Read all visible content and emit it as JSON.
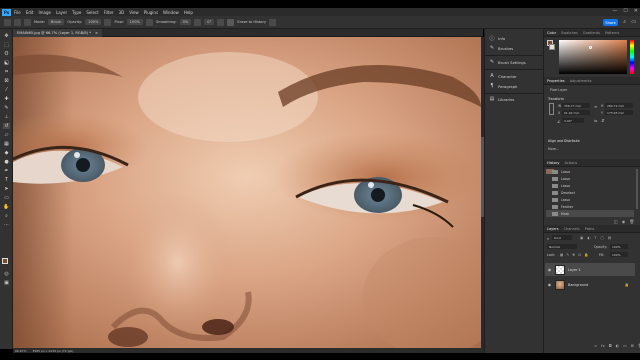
{
  "app": {
    "logo": "Ps"
  },
  "menu": [
    "File",
    "Edit",
    "Image",
    "Layer",
    "Type",
    "Select",
    "Filter",
    "3D",
    "View",
    "Plugins",
    "Window",
    "Help"
  ],
  "window_controls": {
    "minimize": "—",
    "maximize": "☐",
    "close": "✕"
  },
  "options": {
    "mode_label": "Mode:",
    "mode_value": "Brush",
    "opacity_label": "Opacity:",
    "opacity_value": "100%",
    "flow_label": "Flow:",
    "flow_value": "100%",
    "smoothing_label": "Smoothing:",
    "smoothing_value": "0%",
    "angle_value": "0°",
    "erase_history_label": "Erase to History",
    "share_label": "Share"
  },
  "document": {
    "tab_title": "EMAIN65.jpg @ 66.7% (Layer 1, RGB/8) *",
    "close": "×"
  },
  "status": {
    "zoom": "66.67%",
    "size": "3585 px x 2239 px (72 ppi)"
  },
  "dock_items": [
    {
      "icon": "info-icon",
      "glyph": "ⓘ",
      "label": "Info"
    },
    {
      "icon": "brushes-icon",
      "glyph": "✎",
      "label": "Brushes"
    },
    {
      "icon": "brush-settings-icon",
      "glyph": "✎",
      "label": "Brush Settings"
    },
    {
      "icon": "character-icon",
      "glyph": "A",
      "label": "Character"
    },
    {
      "icon": "paragraph-icon",
      "glyph": "¶",
      "label": "Paragraph"
    },
    {
      "icon": "libraries-icon",
      "glyph": "▤",
      "label": "Libraries"
    }
  ],
  "color_panel": {
    "tabs": [
      "Color",
      "Swatches",
      "Gradients",
      "Patterns"
    ]
  },
  "properties": {
    "tabs": [
      "Properties",
      "Adjustments"
    ],
    "layer_kind": "Pixel Layer",
    "transform_label": "Transform",
    "w_value": "356.77 mm",
    "h_value": "280.72 mm",
    "x_value": "91.42 mm",
    "y_value": "175.95 mm",
    "angle_value": "0.00°",
    "align_label": "Align and Distribute",
    "more_label": "More..."
  },
  "history": {
    "tabs": [
      "History",
      "Actions"
    ],
    "items": [
      "Lasso",
      "Lasso",
      "Lasso",
      "Deselect",
      "Lasso",
      "Feather",
      "Mask"
    ]
  },
  "layers": {
    "tabs": [
      "Layers",
      "Channels",
      "Paths"
    ],
    "kind_label": "Kind",
    "blend_mode": "Normal",
    "opacity_label": "Opacity:",
    "opacity_value": "100%",
    "lock_label": "Lock:",
    "fill_label": "Fill:",
    "fill_value": "100%",
    "items": [
      {
        "name": "Layer 1"
      },
      {
        "name": "Background"
      }
    ]
  },
  "colors": {
    "accent": "#31a8ff",
    "share": "#1473e6",
    "panel": "#323232",
    "foreground": "#7a4a2f",
    "background": "#e9e0d6"
  }
}
